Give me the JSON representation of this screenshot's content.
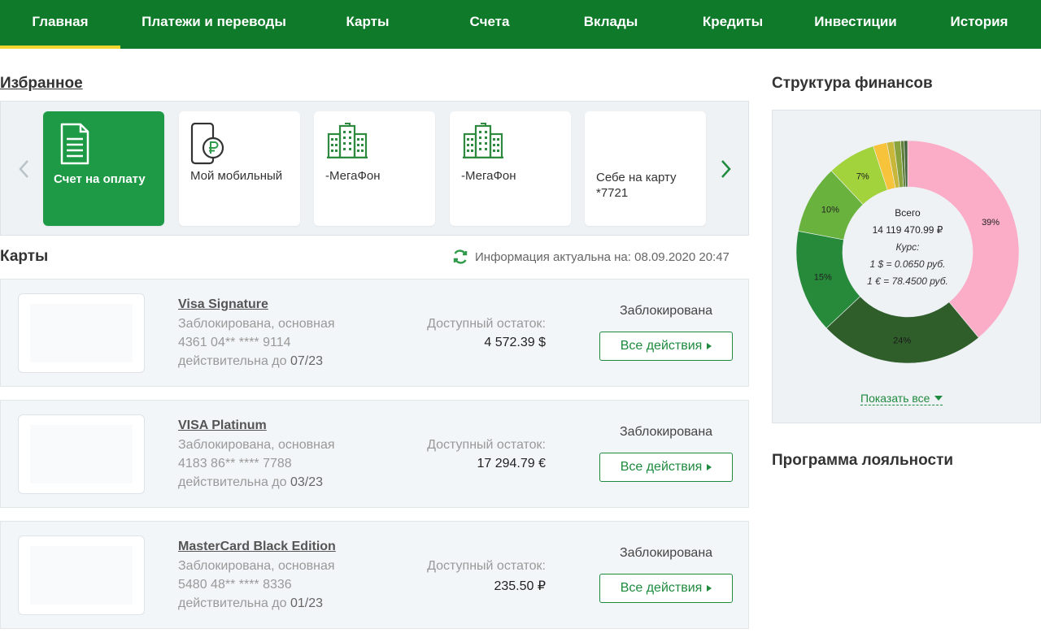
{
  "nav": {
    "items": [
      "Главная",
      "Платежи и переводы",
      "Карты",
      "Счета",
      "Вклады",
      "Кредиты",
      "Инвестиции",
      "История"
    ],
    "active_index": 0,
    "accent": "#f2d52e",
    "background": "#0e7a2a"
  },
  "favorites": {
    "title": "Избранное",
    "items": [
      {
        "label": "Счет на оплату",
        "icon": "document-icon"
      },
      {
        "label": "Мой мобильный",
        "icon": "phone-ruble-icon"
      },
      {
        "label": "-МегаФон",
        "icon": "building-icon"
      },
      {
        "label": "-МегаФон",
        "icon": "building-icon"
      },
      {
        "label": "Себе на карту *7721",
        "icon": ""
      }
    ]
  },
  "cards": {
    "title": "Карты",
    "updated": "Информация актуальна на: 08.09.2020 20:47",
    "balance_label": "Доступный остаток:",
    "actions_label": "Все действия",
    "items": [
      {
        "name": "Visa Signature",
        "status_line": "Заблокирована, основная",
        "number": "4361 04** **** 9114",
        "valid_prefix": "действительна до",
        "valid": "07/23",
        "balance": "4 572.39 $",
        "status": "Заблокирована"
      },
      {
        "name": "VISA Platinum",
        "status_line": "Заблокирована, основная",
        "number": "4183 86** **** 7788",
        "valid_prefix": "действительна до",
        "valid": "03/23",
        "balance": "17 294.79 €",
        "status": "Заблокирована"
      },
      {
        "name": "MasterCard Black Edition",
        "status_line": "Заблокирована, основная",
        "number": "5480 48** **** 8336",
        "valid_prefix": "действительна до",
        "valid": "01/23",
        "balance": "235.50 ₽",
        "status": "Заблокирована"
      }
    ]
  },
  "finance": {
    "title": "Структура финансов",
    "total_label": "Всего",
    "total": "14 119 470.99 ₽",
    "rate_label": "Курс:",
    "rate_usd": "1 $ = 0.0650 руб.",
    "rate_eur": "1 € = 78.4500 руб.",
    "show_all": "Показать все"
  },
  "chart_data": {
    "type": "pie",
    "donut": true,
    "values": [
      39,
      24,
      15,
      10,
      7,
      2,
      1,
      1,
      0.5,
      0.5
    ],
    "data_labels": [
      "39%",
      "24%",
      "15%",
      "10%",
      "7%",
      "",
      "",
      "",
      "",
      ""
    ],
    "colors": [
      "#fbacc6",
      "#2f5e2b",
      "#278a3a",
      "#6ab23e",
      "#a2d23c",
      "#f6c33b",
      "#c9b73a",
      "#8aa33c",
      "#5f7f3a",
      "#44643a"
    ]
  },
  "loyalty": {
    "title": "Программа лояльности"
  }
}
